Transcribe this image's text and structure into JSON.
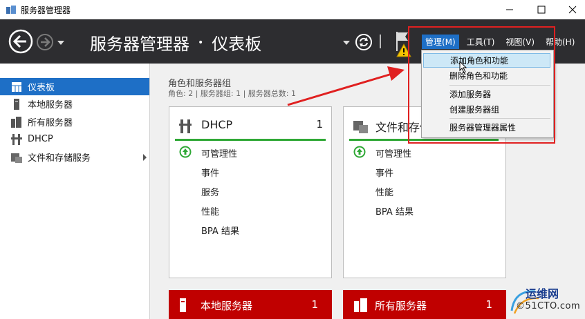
{
  "window": {
    "title": "服务器管理器"
  },
  "header": {
    "breadcrumb_app": "服务器管理器",
    "breadcrumb_sep": "•",
    "breadcrumb_page": "仪表板",
    "menus": [
      "管理(M)",
      "工具(T)",
      "视图(V)",
      "帮助(H)"
    ]
  },
  "sidebar": {
    "items": [
      {
        "label": "仪表板",
        "icon": "dashboard-icon"
      },
      {
        "label": "本地服务器",
        "icon": "server-icon"
      },
      {
        "label": "所有服务器",
        "icon": "servers-icon"
      },
      {
        "label": "DHCP",
        "icon": "dhcp-icon"
      },
      {
        "label": "文件和存储服务",
        "icon": "storage-icon"
      }
    ]
  },
  "main": {
    "section_title": "角色和服务器组",
    "section_sub": "角色: 2 | 服务器组: 1 | 服务器总数: 1",
    "cards": [
      {
        "title": "DHCP",
        "count": "1",
        "rows": [
          "可管理性",
          "事件",
          "服务",
          "性能",
          "BPA 结果"
        ]
      },
      {
        "title": "文件和存储",
        "count": "",
        "rows": [
          "可管理性",
          "事件",
          "性能",
          "BPA 结果"
        ]
      }
    ],
    "red_cards": [
      {
        "title": "本地服务器",
        "count": "1"
      },
      {
        "title": "所有服务器",
        "count": "1"
      }
    ]
  },
  "dropdown": {
    "items": [
      "添加角色和功能",
      "删除角色和功能",
      "添加服务器",
      "创建服务器组",
      "服务器管理器属性"
    ]
  },
  "watermark": {
    "line1": "运维网",
    "line2": "©51CTO.com"
  },
  "colors": {
    "accent": "#1e6fc6",
    "header_bg": "#2d2d30",
    "status_green": "#2fa836",
    "tile_red": "#c00000",
    "annotation_red": "#e02020"
  }
}
